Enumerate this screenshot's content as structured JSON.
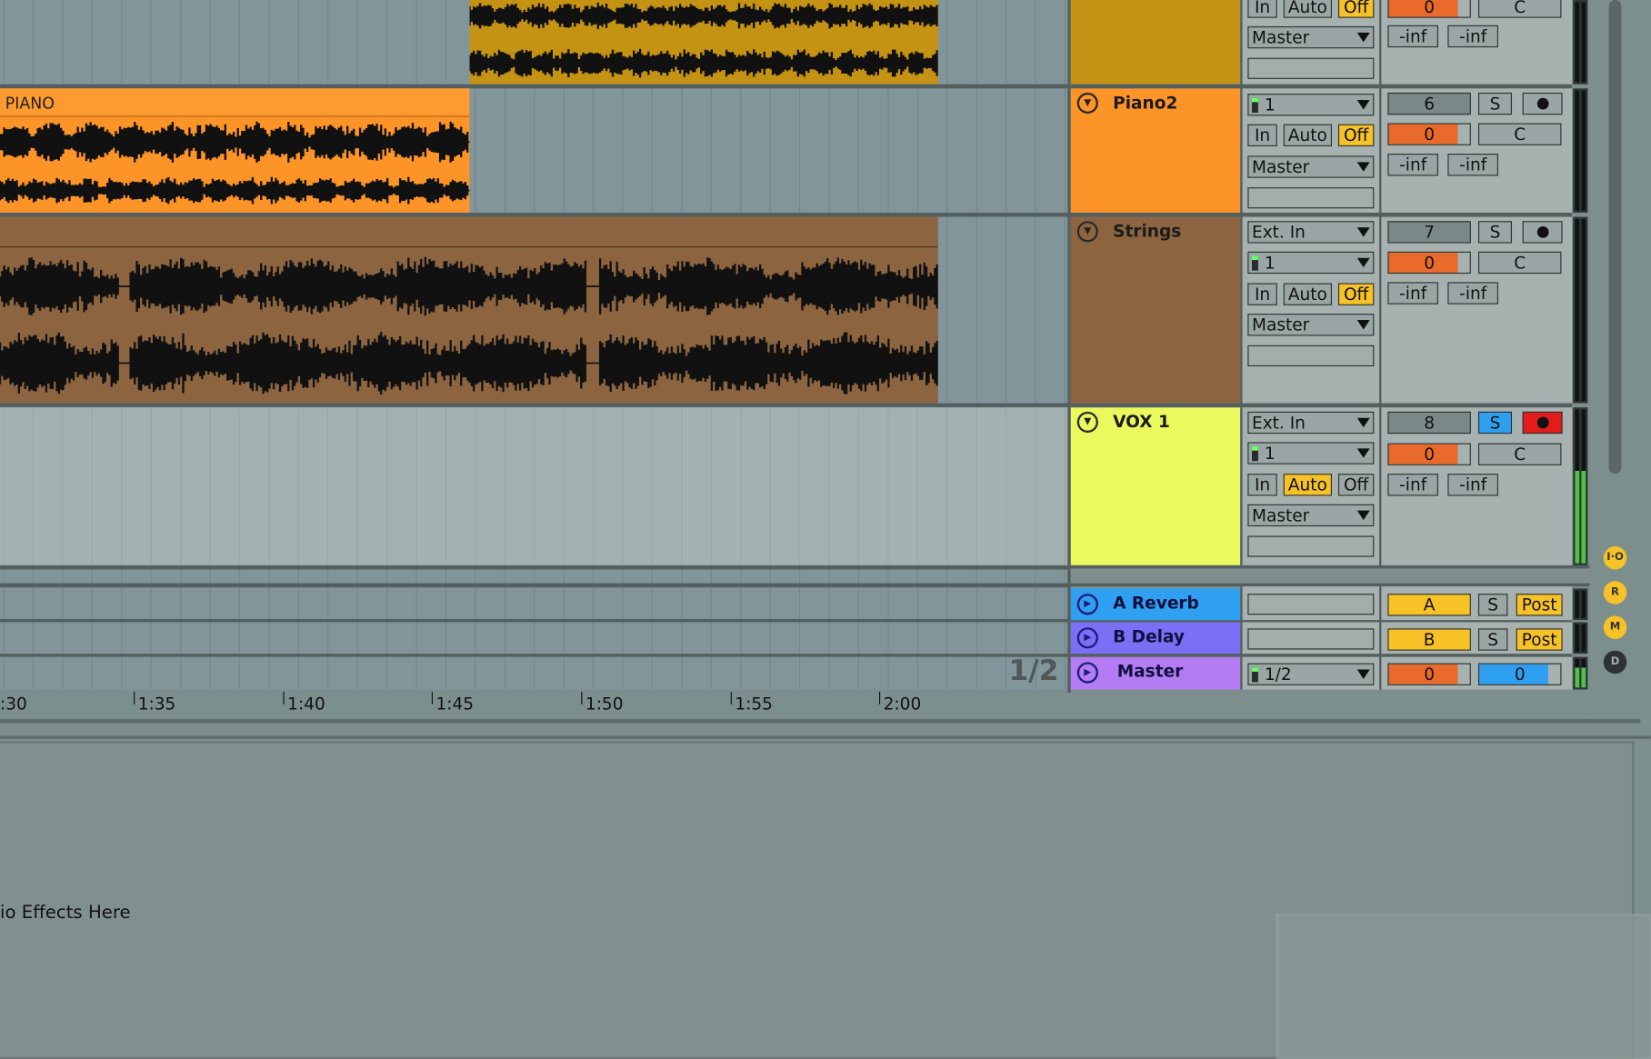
{
  "tracks": [
    {
      "name": "",
      "io": {
        "in": "In",
        "auto": "Auto",
        "off": "Off",
        "output": "Master",
        "monitor_state": "Off"
      },
      "mixer": {
        "volume": "0",
        "pan": "C",
        "peak_left": "-inf",
        "peak_right": "-inf"
      },
      "color": "#c49313"
    },
    {
      "name": "Piano2",
      "clip_label": "PIANO",
      "io": {
        "input_channel": "1",
        "in": "In",
        "auto": "Auto",
        "off": "Off",
        "output": "Master",
        "monitor_state": "Off"
      },
      "mixer": {
        "track_number": "6",
        "solo": "S",
        "volume": "0",
        "pan": "C",
        "peak_left": "-inf",
        "peak_right": "-inf"
      },
      "color": "#fd9428"
    },
    {
      "name": "Strings",
      "io": {
        "input_type": "Ext. In",
        "input_channel": "1",
        "in": "In",
        "auto": "Auto",
        "off": "Off",
        "output": "Master",
        "monitor_state": "Off"
      },
      "mixer": {
        "track_number": "7",
        "solo": "S",
        "volume": "0",
        "pan": "C",
        "peak_left": "-inf",
        "peak_right": "-inf"
      },
      "color": "#8c6540"
    },
    {
      "name": "VOX 1",
      "io": {
        "input_type": "Ext. In",
        "input_channel": "1",
        "in": "In",
        "auto": "Auto",
        "off": "Off",
        "output": "Master",
        "monitor_state": "Auto"
      },
      "mixer": {
        "track_number": "8",
        "solo": "S",
        "volume": "0",
        "pan": "C",
        "peak_left": "-inf",
        "peak_right": "-inf",
        "armed": true,
        "soloed": true
      },
      "color": "#eaf95d"
    }
  ],
  "returns": [
    {
      "name": "A Reverb",
      "send_label": "A",
      "solo": "S",
      "mode": "Post",
      "color": "#2f9ff2"
    },
    {
      "name": "B Delay",
      "send_label": "B",
      "solo": "S",
      "mode": "Post",
      "color": "#7a70f5"
    }
  ],
  "master": {
    "name": "Master",
    "cue_out": "1/2",
    "volume": "0",
    "pan": "0",
    "color": "#b37cf2"
  },
  "arrangement": {
    "loop_overlay": "1/2"
  },
  "ruler": {
    "labels": [
      ":30",
      "1:35",
      "1:40",
      "1:45",
      "1:50",
      "1:55",
      "2:00"
    ]
  },
  "side_buttons": {
    "io": "I·O",
    "returns": "R",
    "mixer": "M",
    "delay": "D"
  },
  "device_view": {
    "hint": "io Effects Here"
  },
  "colors": {
    "accent_yellow": "#f7c226",
    "vol_orange": "#ea6a2b",
    "solo_blue": "#2f9ff2",
    "arm_red": "#e21b1b"
  }
}
